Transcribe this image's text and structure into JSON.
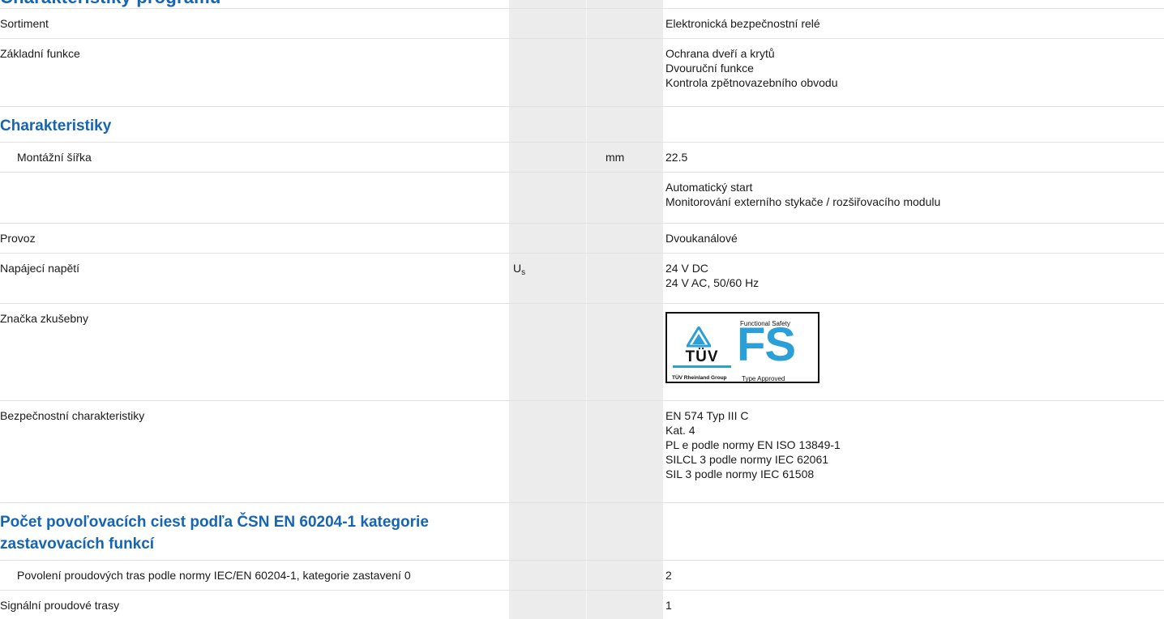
{
  "top_title": "Charakteristiky programu",
  "rows": {
    "sortiment": {
      "label": "Sortiment",
      "value": [
        "Elektronická bezpečnostní relé"
      ]
    },
    "zakladni_funkce": {
      "label": "Základní funkce",
      "value": [
        "Ochrana dveří a krytů",
        "Dvouruční funkce",
        "Kontrola zpětnovazebního obvodu"
      ]
    },
    "charakteristiky_heading": "Charakteristiky",
    "montazni_sirka": {
      "label": "Montážní šířka",
      "unit": "mm",
      "value": [
        "22.5"
      ]
    },
    "start": {
      "value": [
        "Automatický start",
        "Monitorování externího stykače / rozšiřovacího modulu"
      ]
    },
    "provoz": {
      "label": "Provoz",
      "value": [
        "Dvoukanálové"
      ]
    },
    "napajeci_napeti": {
      "label": "Napájecí napětí",
      "symbol": "U",
      "symbol_sub": "s",
      "value": [
        "24 V DC",
        "24 V AC, 50/60 Hz"
      ]
    },
    "znacka_zkusebny": {
      "label": "Značka zkušebny"
    },
    "bezpecnostni": {
      "label": "Bezpečnostní charakteristiky",
      "value": [
        "EN 574 Typ III C",
        "Kat. 4",
        "PL e podle normy EN ISO 13849-1",
        "SILCL 3 podle normy IEC 62061",
        "SIL 3 podle normy IEC 61508"
      ]
    },
    "pocet_heading": [
      "Počet povoľovacích ciest podľa ČSN EN 60204-1 kategorie",
      "zastavovacích funkcí"
    ],
    "povoleni": {
      "label": "Povolení proudových tras podle normy IEC/EN 60204-1, kategorie zastavení 0",
      "value": [
        "2"
      ]
    },
    "signalni": {
      "label": "Signální proudové trasy",
      "value": [
        "1"
      ]
    }
  },
  "badge": {
    "tuv": "TÜV",
    "group": "TÜV Rheinland Group",
    "fs_top": "Functional Safety",
    "fs": "FS",
    "fs_bottom": "Type Approved"
  },
  "colors": {
    "heading_blue": "#1565b2",
    "badge_blue": "#2a9fd8",
    "band_gray": "#ececec"
  }
}
